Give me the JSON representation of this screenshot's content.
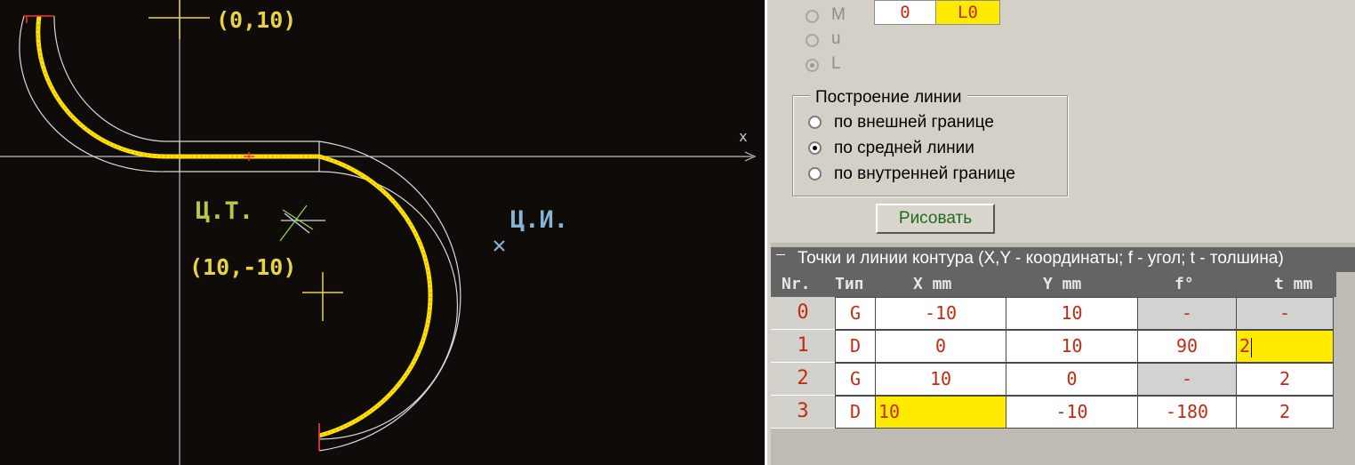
{
  "canvas": {
    "labels": {
      "origin_point": "(0,10)",
      "lower_point": "(10,-10)",
      "center_gravity": "Ц.Т.",
      "center_bend": "Ц.И.",
      "x_axis": "x"
    }
  },
  "panel": {
    "mode_radios": [
      {
        "label": "M",
        "checked": false
      },
      {
        "label": "u",
        "checked": false
      },
      {
        "label": "L",
        "checked": true
      }
    ],
    "top_fields": {
      "value": "0",
      "mode": "L0"
    },
    "build_line": {
      "title": "Построение линии",
      "options": [
        {
          "label": "по внешней границе",
          "checked": false
        },
        {
          "label": "по средней линии",
          "checked": true
        },
        {
          "label": "по внутренней границе",
          "checked": false
        }
      ]
    },
    "draw_button": "Рисовать",
    "contour_table": {
      "title": "Точки и линии контура (X,Y - координаты; f - угол; t - толшина)",
      "headers": [
        "Nr.",
        "Тип",
        "X mm",
        "Y mm",
        "f°",
        "t mm"
      ],
      "rows": [
        {
          "nr": "0",
          "type": "G",
          "x": "-10",
          "y": "10",
          "f": "-",
          "t": "-"
        },
        {
          "nr": "1",
          "type": "D",
          "x": "0",
          "y": "10",
          "f": "90",
          "t": "2"
        },
        {
          "nr": "2",
          "type": "G",
          "x": "10",
          "y": "0",
          "f": "-",
          "t": "2"
        },
        {
          "nr": "3",
          "type": "D",
          "x": "10",
          "y": "-10",
          "f": "-180",
          "t": "2"
        }
      ]
    }
  },
  "colors": {
    "canvas_bg": "#0f0b09",
    "contour_yellow": "#ffe000",
    "edit_yellow": "#ffea00",
    "table_text": "#c32a14"
  }
}
